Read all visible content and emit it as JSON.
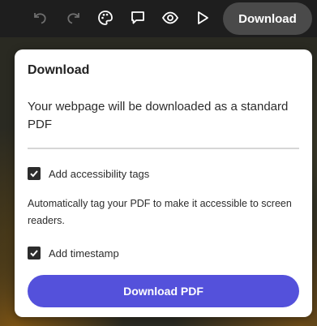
{
  "toolbar": {
    "icons": [
      "undo-icon",
      "redo-icon",
      "theme-palette-icon",
      "comment-icon",
      "preview-eye-icon",
      "play-icon"
    ],
    "download_label": "Download"
  },
  "panel": {
    "title": "Download",
    "description": "Your webpage will be downloaded as a standard PDF",
    "options": [
      {
        "label": "Add accessibility tags",
        "checked": true,
        "help": "Automatically tag your PDF to make it accessible to screen readers."
      },
      {
        "label": "Add timestamp",
        "checked": true
      }
    ],
    "primary_button": "Download PDF"
  },
  "colors": {
    "toolbar_bg": "#1e1e1e",
    "accent": "#5451db",
    "download_pill": "#4a4a4a"
  }
}
